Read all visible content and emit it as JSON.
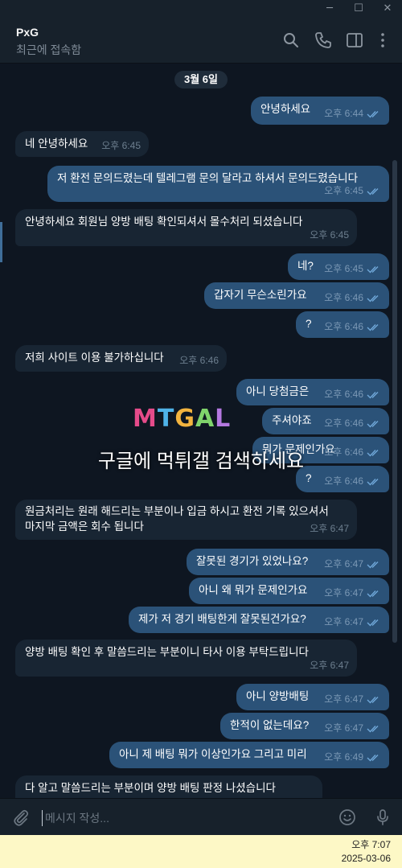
{
  "window": {
    "minimize_icon": "─",
    "maximize_icon": "☐",
    "close_icon": "✕"
  },
  "header": {
    "title": "PxG",
    "status": "최근에 접속함"
  },
  "date_label": "3월 6일",
  "messages": [
    {
      "dir": "out",
      "text": "안녕하세요",
      "time": "오후 6:44"
    },
    {
      "dir": "in",
      "text": "네 안녕하세요",
      "time": "오후 6:45"
    },
    {
      "dir": "out",
      "text": "저 환전 문의드렸는데 텔레그램 문의 달라고 하셔서 문의드렸습니다",
      "time": "오후 6:45"
    },
    {
      "dir": "in",
      "text": "안녕하세요 회원님 양방 배팅 확인되셔서 몰수처리 되셨습니다",
      "time": "오후 6:45"
    },
    {
      "dir": "out",
      "text": "네?",
      "time": "오후 6:45"
    },
    {
      "dir": "out",
      "text": "갑자기 무슨소린가요",
      "time": "오후 6:46"
    },
    {
      "dir": "out",
      "text": "?",
      "time": "오후 6:46"
    },
    {
      "dir": "in",
      "text": "저희 사이트 이용 불가하십니다",
      "time": "오후 6:46"
    },
    {
      "dir": "out",
      "text": "아니 당첨금은",
      "time": "오후 6:46"
    },
    {
      "dir": "out",
      "text": "주셔야죠",
      "time": "오후 6:46"
    },
    {
      "dir": "out",
      "text": "뭐가 문제인가요",
      "time": "오후 6:46"
    },
    {
      "dir": "out",
      "text": "?",
      "time": "오후 6:46"
    },
    {
      "dir": "in",
      "text": "원금처리는 원래 해드리는 부분이나 입금 하시고 환전 기록 있으셔서",
      "text2": "마지막 금액은 회수 됩니다",
      "time": "오후 6:47"
    },
    {
      "dir": "out",
      "text": "잘못된 경기가 있었나요?",
      "time": "오후 6:47"
    },
    {
      "dir": "out",
      "text": "아니 왜 뭐가 문제인가요",
      "time": "오후 6:47"
    },
    {
      "dir": "out",
      "text": "제가 저 경기 배팅한게 잘못된건가요?",
      "time": "오후 6:47"
    },
    {
      "dir": "in",
      "text": "양방 배팅 확인 후 말씀드리는 부분이니 타사 이용 부탁드립니다",
      "time": "오후 6:47"
    },
    {
      "dir": "out",
      "text": "아니 양방배팅",
      "time": "오후 6:47"
    },
    {
      "dir": "out",
      "text": "한적이 없는데요?",
      "time": "오후 6:47"
    },
    {
      "dir": "out",
      "text": "아니 제 배팅 뭐가 이상인가요 그리고 미리",
      "time": "오후 6:49"
    },
    {
      "dir": "in",
      "text": "다 알고 말씀드리는 부분이며 양방 배팅 판정 나셨습니다",
      "time": ""
    }
  ],
  "watermark": {
    "logo_letters": [
      "M",
      "T",
      "G",
      "A",
      "L"
    ],
    "logo_colors": [
      "#e54b8a",
      "#4fb3e8",
      "#f3b43f",
      "#7fd36b",
      "#b478e0"
    ],
    "text": "구글에 먹튀갤 검색하세요"
  },
  "composer": {
    "placeholder": "메시지 작성..."
  },
  "taskbar": {
    "time": "오후 7:07",
    "date": "2025-03-06"
  },
  "colors": {
    "bg": "#0e1621",
    "header": "#17212b",
    "bubble_out": "#2b5278",
    "bubble_in": "#182533"
  }
}
